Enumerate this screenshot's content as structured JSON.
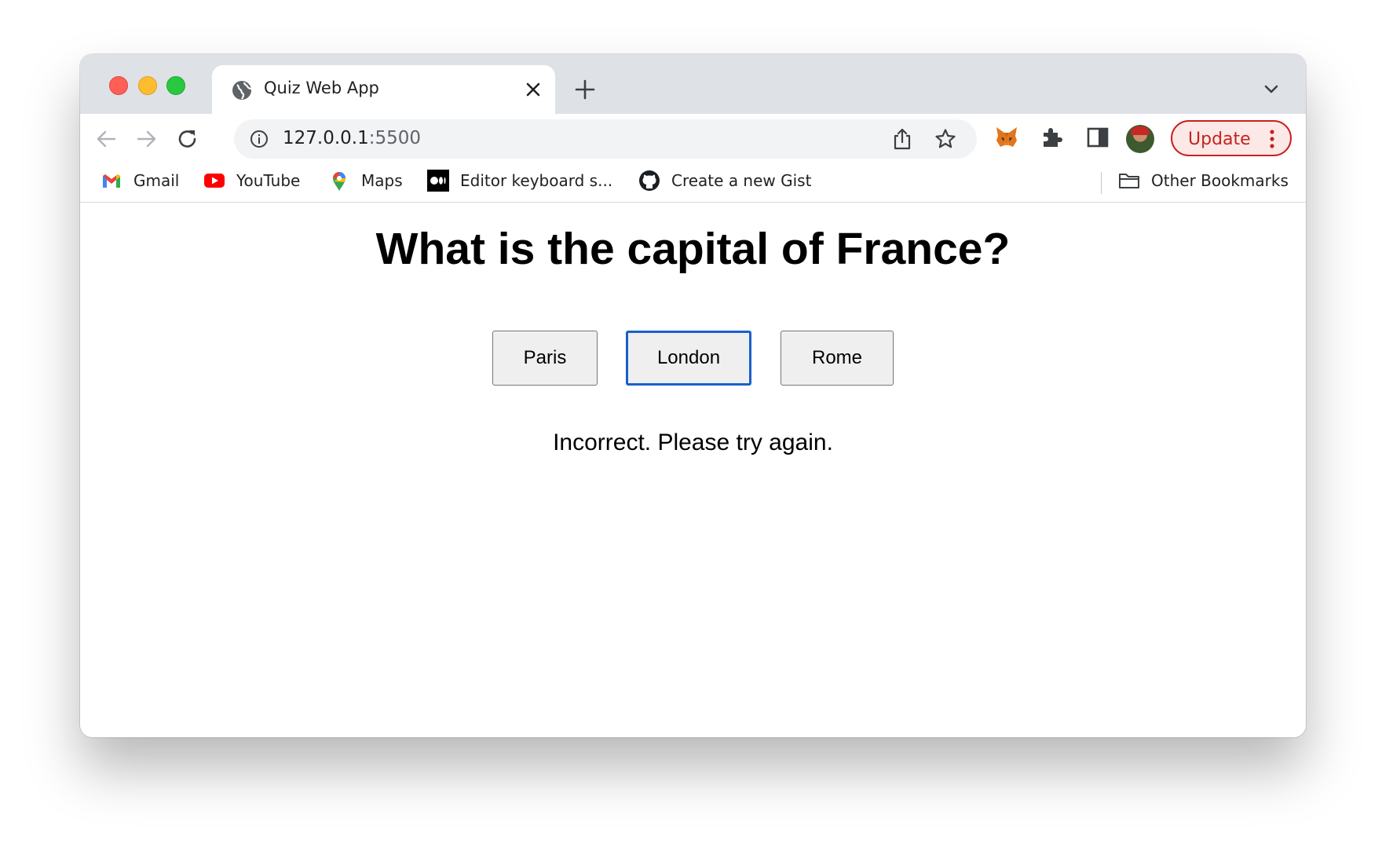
{
  "tab": {
    "title": "Quiz Web App"
  },
  "address_bar": {
    "host": "127.0.0.1",
    "port": ":5500"
  },
  "toolbar": {
    "update_label": "Update"
  },
  "bookmarks": [
    {
      "label": "Gmail",
      "icon": "gmail-icon"
    },
    {
      "label": "YouTube",
      "icon": "youtube-icon"
    },
    {
      "label": "Maps",
      "icon": "maps-icon"
    },
    {
      "label": "Editor keyboard s...",
      "icon": "medium-icon"
    },
    {
      "label": "Create a new Gist",
      "icon": "github-icon"
    }
  ],
  "other_bookmarks": "Other Bookmarks",
  "quiz": {
    "question": "What is the capital of France?",
    "answers": [
      "Paris",
      "London",
      "Rome"
    ],
    "focused_answer": "London",
    "feedback": "Incorrect. Please try again."
  },
  "colors": {
    "update_accent": "#c5221f",
    "focus_ring": "#1a5fc9"
  }
}
